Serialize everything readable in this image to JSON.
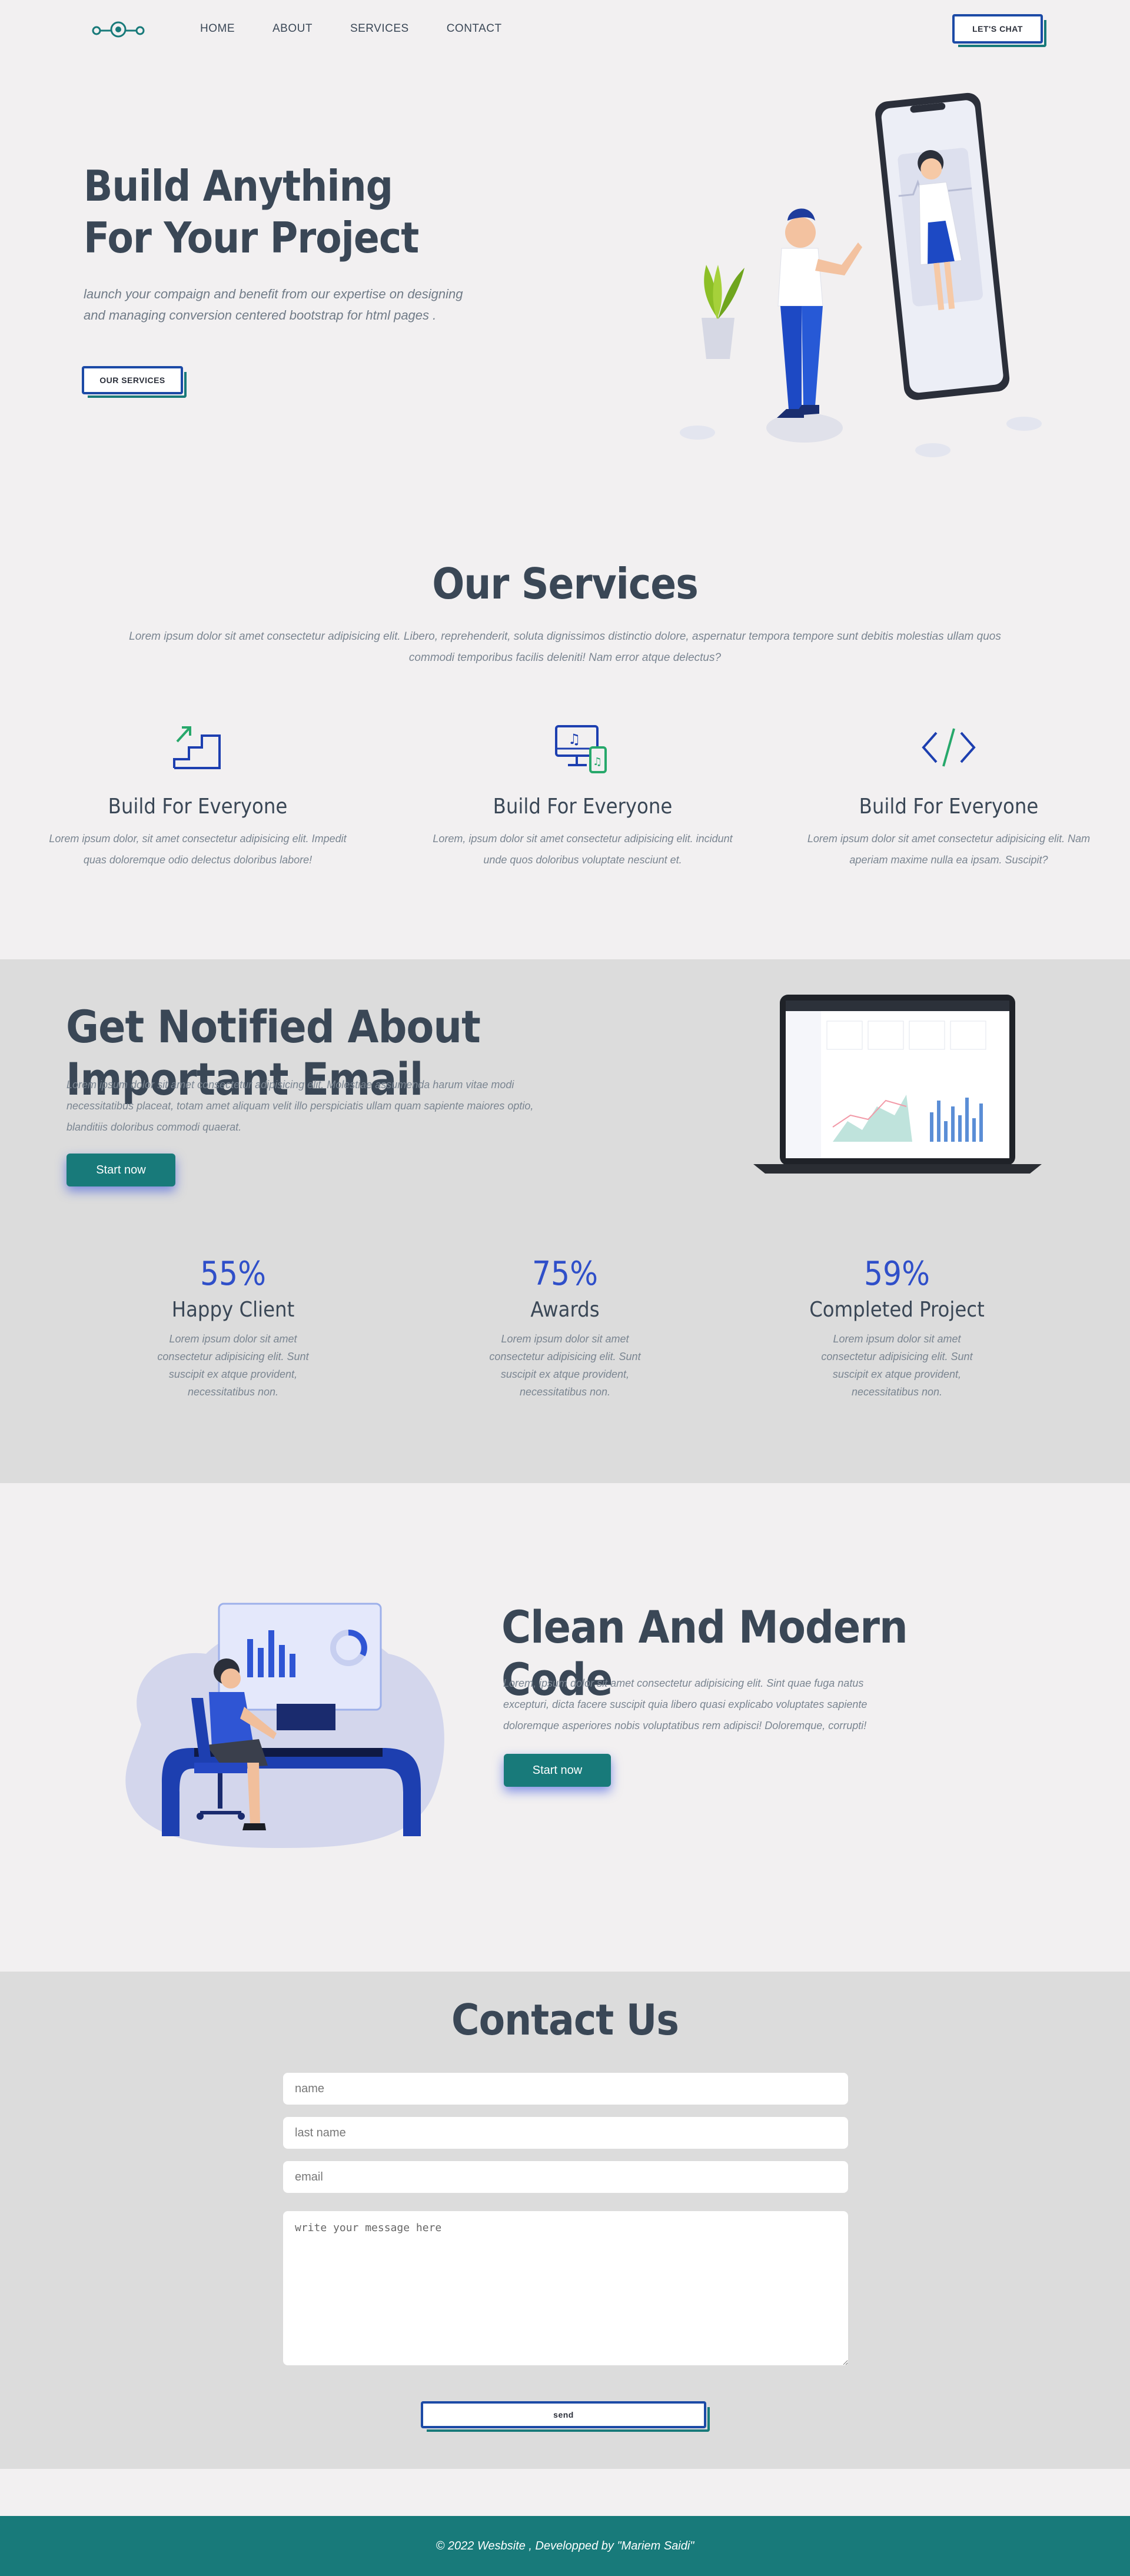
{
  "nav": {
    "logo": "logo",
    "links": [
      "HOME",
      "ABOUT",
      "SERVICES",
      "CONTACT"
    ],
    "cta_label": "LET'S CHAT"
  },
  "hero": {
    "title_line1": "Build Anything",
    "title_line2": "For Your Project",
    "text": "launch your compaign and benefit from our expertise on designing and managing conversion centered bootstrap for html pages .",
    "button_label": "OUR SERVICES"
  },
  "services": {
    "title": "Our Services",
    "subtitle": "Lorem ipsum dolor sit amet consectetur adipisicing elit. Libero, reprehenderit, soluta dignissimos distinctio dolore, aspernatur tempora tempore sunt debitis molestias ullam quos commodi temporibus facilis deleniti! Nam error atque delectus?",
    "items": [
      {
        "icon": "stairs-growth-icon",
        "title": "Build For Everyone",
        "text": "Lorem ipsum dolor, sit amet consectetur adipisicing elit. Impedit quas doloremque odio delectus doloribus labore!"
      },
      {
        "icon": "desktop-mobile-music-icon",
        "title": "Build For Everyone",
        "text": "Lorem, ipsum dolor sit amet consectetur adipisicing elit. incidunt unde quos doloribus voluptate nesciunt et."
      },
      {
        "icon": "code-icon",
        "title": "Build For Everyone",
        "text": "Lorem ipsum dolor sit amet consectetur adipisicing elit. Nam aperiam maxime nulla ea ipsam. Suscipit?"
      }
    ]
  },
  "notified": {
    "title": "Get Notified About Important Email",
    "text": "Lorem ipsum dolor sit amet consectetur adipisicing elit. Molestiae assumenda harum vitae modi necessitatibus placeat, totam amet aliquam velit illo perspiciatis ullam quam sapiente maiores optio, blanditiis doloribus commodi quaerat.",
    "button_label": "Start now",
    "stats": [
      {
        "value": "55%",
        "label": "Happy Client",
        "text": "Lorem ipsum dolor sit amet consectetur adipisicing elit. Sunt suscipit ex atque provident, necessitatibus non."
      },
      {
        "value": "75%",
        "label": "Awards",
        "text": "Lorem ipsum dolor sit amet consectetur adipisicing elit. Sunt suscipit ex atque provident, necessitatibus non."
      },
      {
        "value": "59%",
        "label": "Completed Project",
        "text": "Lorem ipsum dolor sit amet consectetur adipisicing elit. Sunt suscipit ex atque provident, necessitatibus non."
      }
    ]
  },
  "code": {
    "title": "Clean And Modern Code",
    "text": "Lorem, ipsum dolor sit amet consectetur adipisicing elit. Sint quae fuga natus excepturi, dicta facere suscipit quia libero quasi explicabo voluptates sapiente doloremque asperiores nobis voluptatibus rem adipisci! Doloremque, corrupti!",
    "button_label": "Start now"
  },
  "contact": {
    "title": "Contact Us",
    "name_placeholder": "name",
    "lastname_placeholder": "last name",
    "email_placeholder": "email",
    "message_placeholder": "write your message here",
    "send_label": "send"
  },
  "footer": {
    "text": "© 2022 Wesbsite , Developped by \"Mariem Saidi\""
  },
  "colors": {
    "teal": "#187a7a",
    "blue": "#1c4aa6",
    "stat_blue": "#2f4fc9",
    "heading": "#3a4756",
    "background": "#f2f0f1",
    "section_gray": "#dcdcdc"
  }
}
